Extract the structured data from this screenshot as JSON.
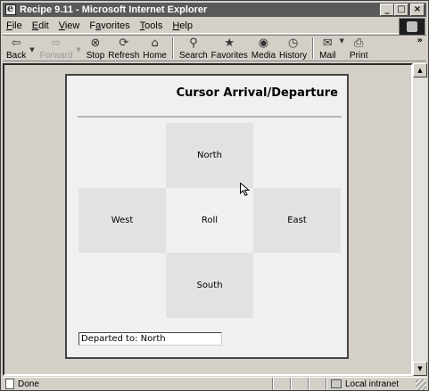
{
  "window": {
    "title": "Recipe 9.11 - Microsoft Internet Explorer",
    "minimize": "_",
    "maximize": "□",
    "close": "×"
  },
  "menu": {
    "items": [
      {
        "ul": "F",
        "rest": "ile"
      },
      {
        "ul": "E",
        "rest": "dit"
      },
      {
        "ul": "V",
        "rest": "iew"
      },
      {
        "pre": "F",
        "ul": "a",
        "rest": "vorites"
      },
      {
        "ul": "T",
        "rest": "ools"
      },
      {
        "ul": "H",
        "rest": "elp"
      }
    ]
  },
  "toolbar": {
    "buttons": [
      {
        "label": "Back",
        "icon": "back-arrow-icon",
        "glyph": "⇦",
        "enabled": true,
        "dropdown": true
      },
      {
        "label": "Forward",
        "icon": "forward-arrow-icon",
        "glyph": "⇨",
        "enabled": false,
        "dropdown": true
      },
      {
        "label": "Stop",
        "icon": "stop-icon",
        "glyph": "⊗",
        "enabled": true
      },
      {
        "label": "Refresh",
        "icon": "refresh-icon",
        "glyph": "⟳",
        "enabled": true
      },
      {
        "label": "Home",
        "icon": "home-icon",
        "glyph": "⌂",
        "enabled": true
      },
      {
        "label": "Search",
        "icon": "search-icon",
        "glyph": "⚲",
        "enabled": true
      },
      {
        "label": "Favorites",
        "icon": "favorites-icon",
        "glyph": "★",
        "enabled": true
      },
      {
        "label": "Media",
        "icon": "media-icon",
        "glyph": "◉",
        "enabled": true
      },
      {
        "label": "History",
        "icon": "history-icon",
        "glyph": "◷",
        "enabled": true
      },
      {
        "label": "Mail",
        "icon": "mail-icon",
        "glyph": "✉",
        "enabled": true,
        "dropdown": true
      },
      {
        "label": "Print",
        "icon": "print-icon",
        "glyph": "⎙",
        "enabled": true
      }
    ],
    "more": "»"
  },
  "page": {
    "heading": "Cursor Arrival/Departure",
    "cells": {
      "north": "North",
      "west": "West",
      "roll": "Roll",
      "east": "East",
      "south": "South"
    },
    "status_field": "Departed to: North"
  },
  "statusbar": {
    "text": "Done",
    "zone": "Local intranet"
  }
}
